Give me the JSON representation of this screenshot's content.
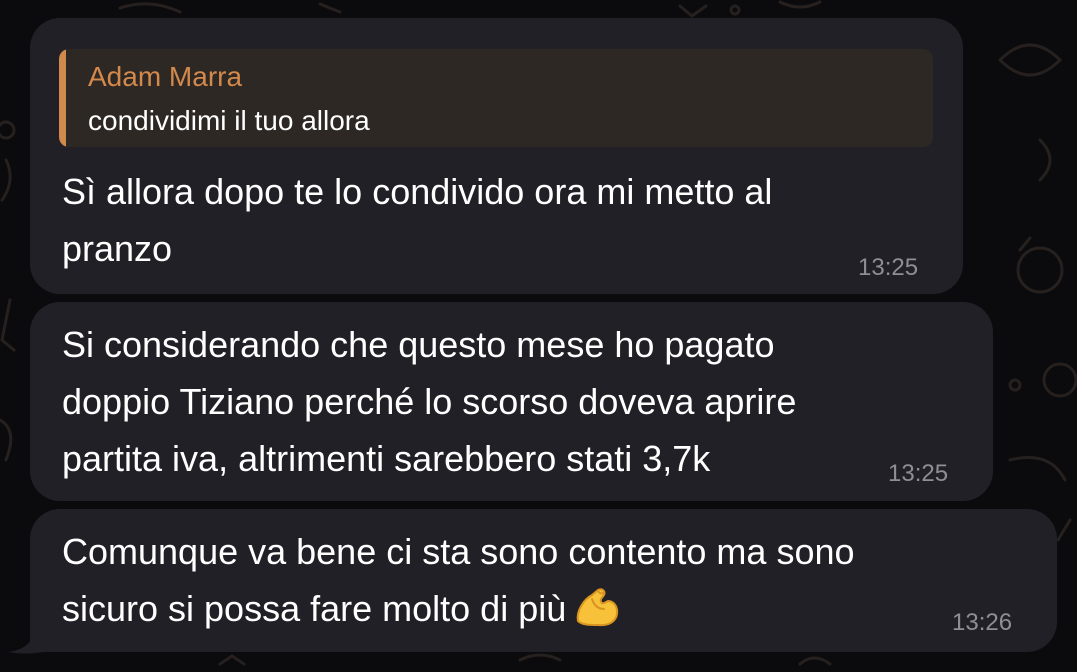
{
  "colors": {
    "background": "#0b0b0d",
    "bubble": "#212026",
    "reply_background": "#2d2823",
    "reply_accent": "#d08a4b",
    "text": "#ffffff",
    "timestamp": "#8f8e94"
  },
  "messages": [
    {
      "reply": {
        "sender": "Adam Marra",
        "text": "condividimi il tuo allora"
      },
      "text": "Sì allora dopo te lo condivido ora mi metto al\npranzo",
      "time": "13:25"
    },
    {
      "text": "Si considerando che questo mese ho pagato\ndoppio Tiziano perché lo scorso doveva aprire\npartita iva, altrimenti sarebbero stati 3,7k",
      "time": "13:25"
    },
    {
      "text": "Comunque va bene ci sta sono contento ma sono\nsicuro si possa fare molto di più",
      "emoji": "flexed-biceps-icon",
      "time": "13:26"
    }
  ]
}
